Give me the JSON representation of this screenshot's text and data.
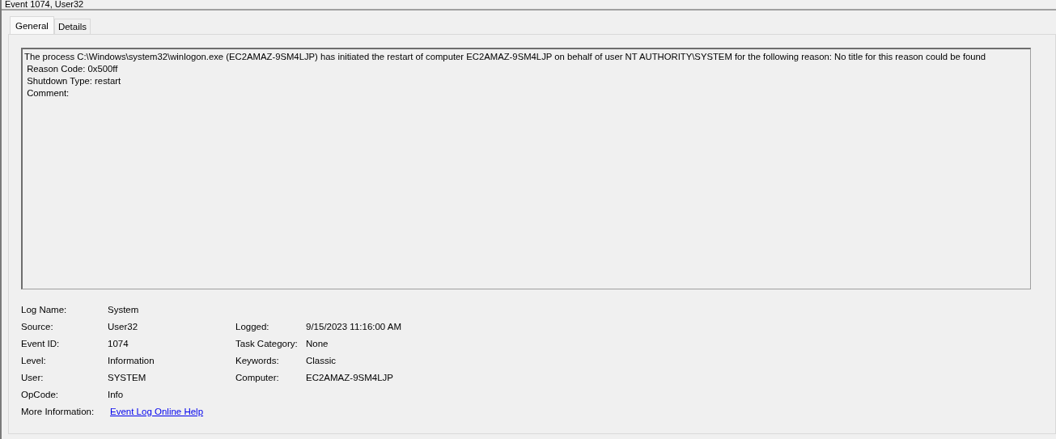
{
  "window": {
    "title": "Event 1074, User32"
  },
  "tabs": [
    {
      "label": "General",
      "selected": true
    },
    {
      "label": "Details",
      "selected": false
    }
  ],
  "description": [
    "The process C:\\Windows\\system32\\winlogon.exe (EC2AMAZ-9SM4LJP) has initiated the restart of computer EC2AMAZ-9SM4LJP on behalf of user NT AUTHORITY\\SYSTEM for the following reason: No title for this reason could be found",
    " Reason Code: 0x500ff",
    " Shutdown Type: restart",
    " Comment:"
  ],
  "rows": [
    {
      "left": {
        "label": "Log Name:",
        "value": "System"
      }
    },
    {
      "left": {
        "label": "Source:",
        "value": "User32"
      },
      "right": {
        "label": "Logged:",
        "value": "9/15/2023 11:16:00 AM"
      }
    },
    {
      "left": {
        "label": "Event ID:",
        "value": "1074"
      },
      "right": {
        "label": "Task Category:",
        "value": "None"
      }
    },
    {
      "left": {
        "label": "Level:",
        "value": "Information"
      },
      "right": {
        "label": "Keywords:",
        "value": "Classic"
      }
    },
    {
      "left": {
        "label": "User:",
        "value": "SYSTEM"
      },
      "right": {
        "label": "Computer:",
        "value": "EC2AMAZ-9SM4LJP"
      }
    },
    {
      "left": {
        "label": "OpCode:",
        "value": "Info"
      }
    }
  ],
  "more_information": {
    "label": "More Information:",
    "link": "Event Log Online Help"
  }
}
